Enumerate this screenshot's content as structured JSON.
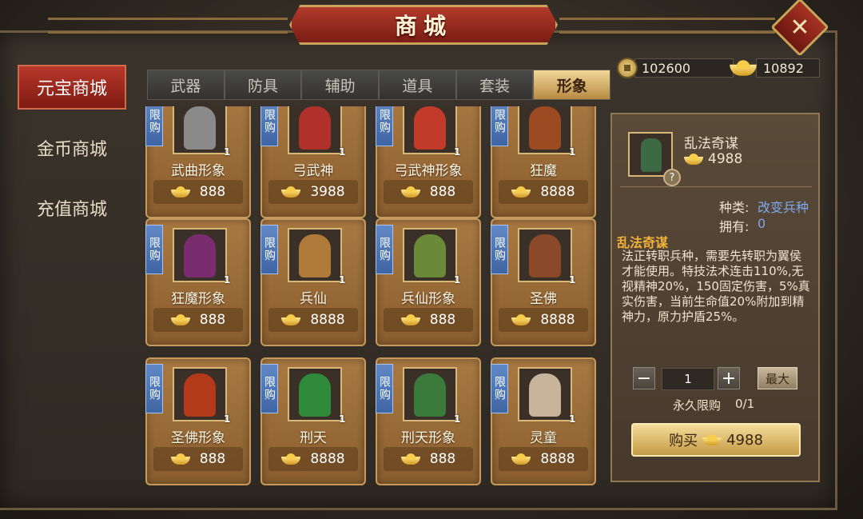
{
  "title": "商城",
  "close_label": "✕",
  "sidebar": {
    "items": [
      {
        "label": "元宝商城",
        "active": true
      },
      {
        "label": "金币商城",
        "active": false
      },
      {
        "label": "充值商城",
        "active": false
      }
    ]
  },
  "tabs": [
    {
      "label": "武器",
      "active": false
    },
    {
      "label": "防具",
      "active": false
    },
    {
      "label": "辅助",
      "active": false
    },
    {
      "label": "道具",
      "active": false
    },
    {
      "label": "套装",
      "active": false
    },
    {
      "label": "形象",
      "active": true
    }
  ],
  "currency": {
    "coins": "102600",
    "ingots": "10892"
  },
  "limit_badge": "限购",
  "items": [
    {
      "name": "武曲形象",
      "price": "888",
      "count": "1",
      "limited": true,
      "color": "#8a8a8a"
    },
    {
      "name": "弓武神",
      "price": "3988",
      "count": "1",
      "limited": true,
      "color": "#b0302a"
    },
    {
      "name": "弓武神形象",
      "price": "888",
      "count": "1",
      "limited": true,
      "color": "#c23a2a"
    },
    {
      "name": "狂魔",
      "price": "8888",
      "count": "1",
      "limited": true,
      "color": "#9c4a22"
    },
    {
      "name": "狂魔形象",
      "price": "888",
      "count": "1",
      "limited": true,
      "color": "#7a2d6e"
    },
    {
      "name": "兵仙",
      "price": "8888",
      "count": "1",
      "limited": true,
      "color": "#b07a3a"
    },
    {
      "name": "兵仙形象",
      "price": "888",
      "count": "1",
      "limited": true,
      "color": "#6a8a3a"
    },
    {
      "name": "圣佛",
      "price": "8888",
      "count": "1",
      "limited": true,
      "color": "#8a4a2a"
    },
    {
      "name": "圣佛形象",
      "price": "888",
      "count": "1",
      "limited": true,
      "color": "#b23a1a"
    },
    {
      "name": "刑天",
      "price": "8888",
      "count": "1",
      "limited": true,
      "color": "#2f8a3a"
    },
    {
      "name": "刑天形象",
      "price": "888",
      "count": "1",
      "limited": true,
      "color": "#3a7a3a"
    },
    {
      "name": "灵童",
      "price": "8888",
      "count": "1",
      "limited": true,
      "color": "#c9b39a"
    }
  ],
  "detail": {
    "name": "乱法奇谋",
    "price": "4988",
    "type_label": "种类:",
    "type_value": "改变兵种",
    "owned_label": "拥有:",
    "owned_value": "0",
    "heading": "乱法奇谋",
    "description": "法正转职兵种，需要先转职为翼侯才能使用。特技法术连击110%,无视精神20%，150固定伤害，5%真实伤害，当前生命值20%附加到精神力，原力护盾25%。",
    "qty": "1",
    "minus": "−",
    "plus": "+",
    "max_label": "最大",
    "limit_text": "永久限购",
    "limit_count": "0/1",
    "buy_label": "购买",
    "buy_price": "4988",
    "question": "?"
  }
}
